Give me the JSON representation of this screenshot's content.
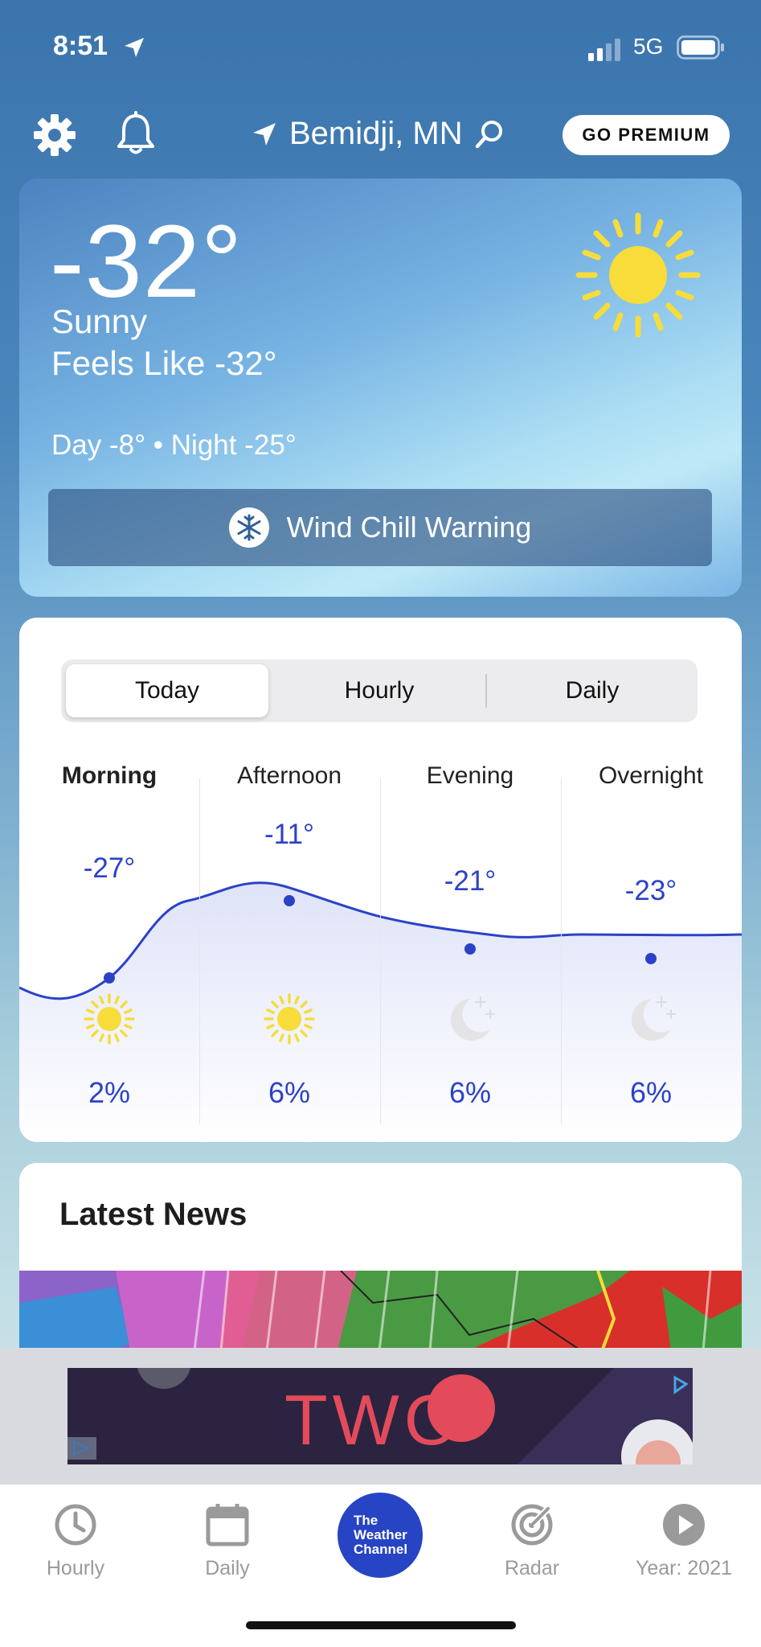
{
  "status_bar": {
    "time": "8:51",
    "network": "5G"
  },
  "header": {
    "location": "Bemidji, MN",
    "premium_label": "GO PREMIUM"
  },
  "current": {
    "temperature": "-32°",
    "condition": "Sunny",
    "feels_like": "Feels Like -32°",
    "day_night": "Day -8° • Night -25°",
    "alert": "Wind Chill Warning"
  },
  "forecast": {
    "tabs": [
      "Today",
      "Hourly",
      "Daily"
    ],
    "active_tab": "Today",
    "periods": [
      {
        "label": "Morning",
        "temp": "-27°",
        "precip": "2%",
        "icon": "sun-icon"
      },
      {
        "label": "Afternoon",
        "temp": "-11°",
        "precip": "6%",
        "icon": "sun-icon"
      },
      {
        "label": "Evening",
        "temp": "-21°",
        "precip": "6%",
        "icon": "moon-stars-icon"
      },
      {
        "label": "Overnight",
        "temp": "-23°",
        "precip": "6%",
        "icon": "moon-stars-icon"
      }
    ]
  },
  "news": {
    "title": "Latest News"
  },
  "ad": {
    "text": "TWO"
  },
  "tabbar": {
    "hourly": "Hourly",
    "daily": "Daily",
    "brand_line1": "The",
    "brand_line2": "Weather",
    "brand_line3": "Channel",
    "radar": "Radar",
    "year": "Year: 2021"
  },
  "colors": {
    "accent_blue": "#2b42c7",
    "brand_blue": "#2744c4",
    "sun_yellow": "#f7dc3a"
  }
}
